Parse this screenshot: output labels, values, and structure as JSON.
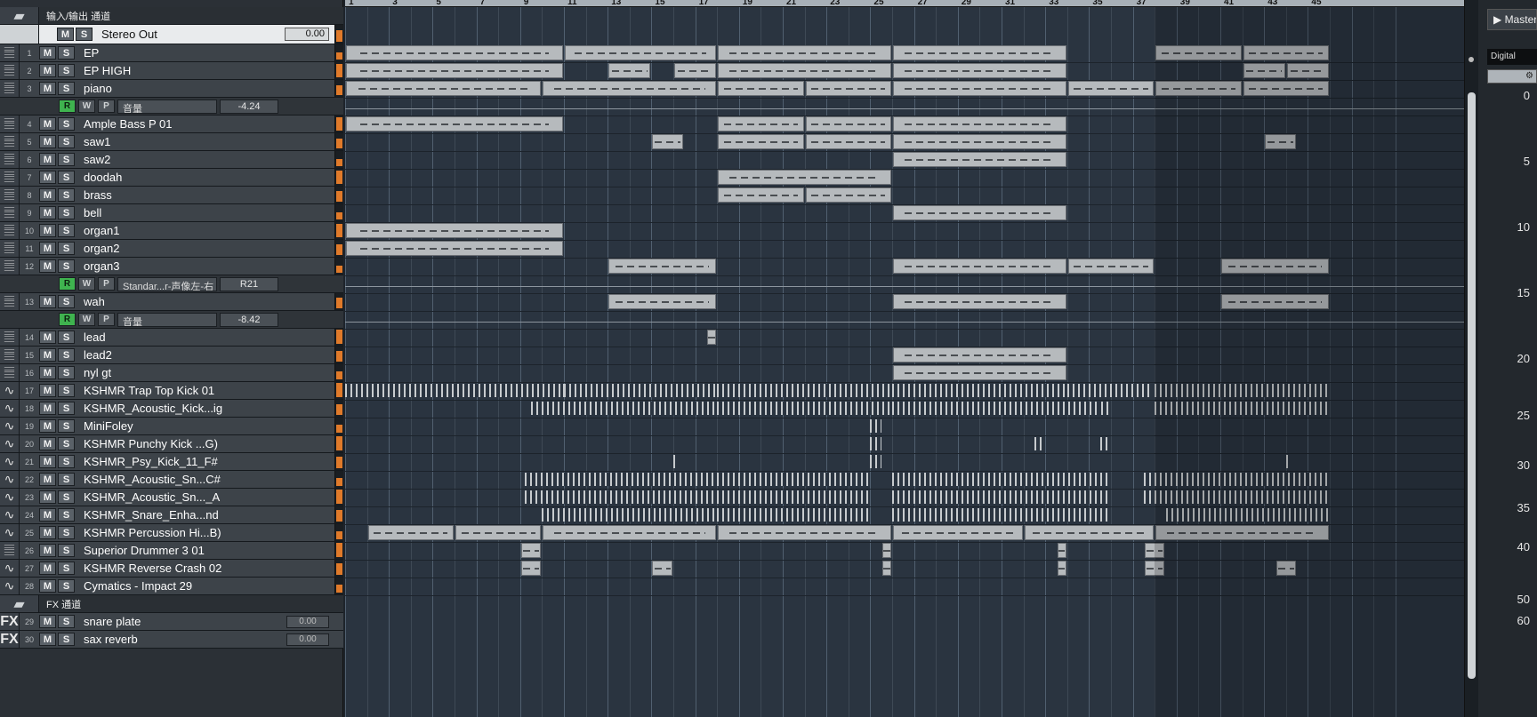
{
  "io_folder_label": "输入/输出 通道",
  "stereo_out": {
    "name": "Stereo Out",
    "value": "0.00"
  },
  "buttons": {
    "mute": "M",
    "solo": "S",
    "read": "R",
    "write": "W",
    "preview": "P"
  },
  "tracks": [
    {
      "num": "1",
      "name": "EP",
      "type": "instrument"
    },
    {
      "num": "2",
      "name": "EP HIGH",
      "type": "instrument"
    },
    {
      "num": "3",
      "name": "piano",
      "type": "instrument"
    },
    {
      "automation": true,
      "param": "音量",
      "value": "-4.24"
    },
    {
      "num": "4",
      "name": "Ample Bass P 01",
      "type": "instrument"
    },
    {
      "num": "5",
      "name": "saw1",
      "type": "instrument"
    },
    {
      "num": "6",
      "name": "saw2",
      "type": "instrument"
    },
    {
      "num": "7",
      "name": "doodah",
      "type": "instrument"
    },
    {
      "num": "8",
      "name": "brass",
      "type": "instrument"
    },
    {
      "num": "9",
      "name": "bell",
      "type": "instrument"
    },
    {
      "num": "10",
      "name": "organ1",
      "type": "instrument"
    },
    {
      "num": "11",
      "name": "organ2",
      "type": "instrument"
    },
    {
      "num": "12",
      "name": "organ3",
      "type": "instrument"
    },
    {
      "automation": true,
      "param": "Standar...r-声像左-右",
      "value": "R21"
    },
    {
      "num": "13",
      "name": "wah",
      "type": "instrument"
    },
    {
      "automation": true,
      "param": "音量",
      "value": "-8.42"
    },
    {
      "num": "14",
      "name": "lead",
      "type": "instrument"
    },
    {
      "num": "15",
      "name": "lead2",
      "type": "instrument"
    },
    {
      "num": "16",
      "name": "nyl gt",
      "type": "instrument"
    },
    {
      "num": "17",
      "name": "KSHMR Trap Top Kick 01",
      "type": "audio"
    },
    {
      "num": "18",
      "name": "KSHMR_Acoustic_Kick...ig",
      "type": "audio"
    },
    {
      "num": "19",
      "name": "MiniFoley",
      "type": "audio"
    },
    {
      "num": "20",
      "name": "KSHMR Punchy Kick ...G)",
      "type": "audio"
    },
    {
      "num": "21",
      "name": "KSHMR_Psy_Kick_11_F#",
      "type": "audio"
    },
    {
      "num": "22",
      "name": "KSHMR_Acoustic_Sn...C#",
      "type": "audio"
    },
    {
      "num": "23",
      "name": "KSHMR_Acoustic_Sn..._A",
      "type": "audio"
    },
    {
      "num": "24",
      "name": "KSHMR_Snare_Enha...nd",
      "type": "audio"
    },
    {
      "num": "25",
      "name": "KSHMR Percussion Hi...B)",
      "type": "audio"
    },
    {
      "num": "26",
      "name": "Superior Drummer 3 01",
      "type": "instrument"
    },
    {
      "num": "27",
      "name": "KSHMR Reverse Crash 02",
      "type": "audio"
    },
    {
      "num": "28",
      "name": "Cymatics - Impact 29",
      "type": "audio"
    }
  ],
  "fx_folder_label": "FX 通道",
  "fx_tracks": [
    {
      "num": "29",
      "name": "snare plate",
      "value": "0.00",
      "tag": "FX"
    },
    {
      "num": "30",
      "name": "sax reverb",
      "value": "0.00",
      "tag": "FX"
    }
  ],
  "ruler": [
    "1",
    "3",
    "5",
    "7",
    "9",
    "11",
    "13",
    "15",
    "17",
    "19",
    "21",
    "23",
    "25",
    "27",
    "29",
    "31",
    "33",
    "35",
    "37",
    "39",
    "41",
    "43",
    "45"
  ],
  "right_panel": {
    "master_tab": "Master",
    "device_label": "Digital",
    "scale": [
      "0",
      "5",
      "10",
      "15",
      "20",
      "25",
      "30",
      "35",
      "40",
      "50",
      "60"
    ]
  },
  "colors": {
    "record_green": "#3fb34f",
    "meter_orange": "#e07a2a",
    "clip_gray": "#b6babd",
    "background": "#2a3440"
  }
}
